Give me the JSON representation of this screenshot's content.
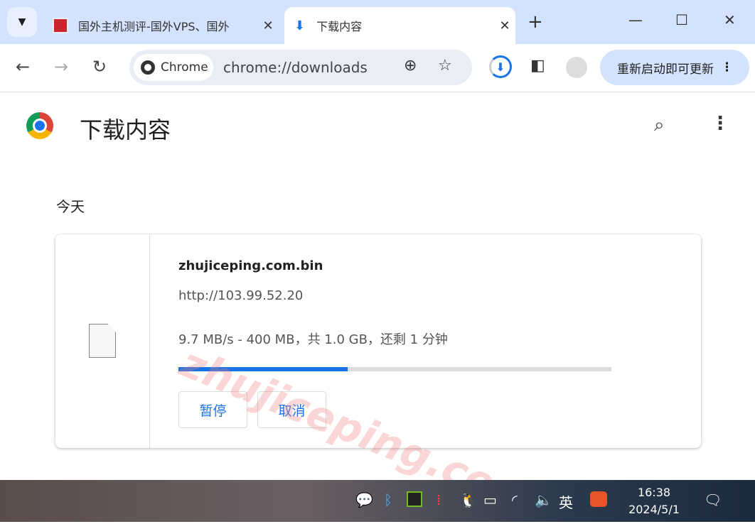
{
  "tabs": [
    {
      "title": "国外主机测评-国外VPS、国外",
      "active": false
    },
    {
      "title": "下载内容",
      "active": true
    }
  ],
  "omnibox": {
    "chip": "Chrome",
    "url": "chrome://downloads"
  },
  "update_button": "重新启动即可更新",
  "page": {
    "title": "下载内容",
    "section": "今天"
  },
  "download": {
    "filename": "zhujiceping.com.bin",
    "source": "http://103.99.52.20",
    "status": "9.7 MB/s - 400 MB，共 1.0 GB，还剩 1 分钟",
    "progress_percent": 39,
    "pause": "暂停",
    "cancel": "取消"
  },
  "watermark": "zhujiceping.com",
  "taskbar": {
    "ime": "英",
    "time": "16:38",
    "date": "2024/5/1"
  },
  "colors": {
    "accent": "#1a73e8",
    "tabbar": "#d3e3fd"
  }
}
